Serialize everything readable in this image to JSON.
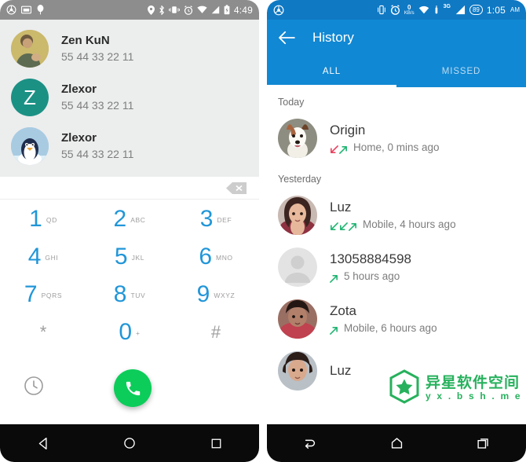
{
  "left_phone": {
    "statusbar": {
      "left_icons": [
        "steering-wheel-icon",
        "sd-card-icon",
        "balloon-icon"
      ],
      "right_icons": [
        "location-icon",
        "bluetooth-icon",
        "vibrate-icon",
        "alarm-icon",
        "wifi-icon",
        "signal-icon",
        "battery-icon"
      ],
      "time": "4:49"
    },
    "contacts": [
      {
        "name": "Zen KuN",
        "number": "55 44 33 22 11",
        "avatar_type": "photo-man",
        "avatar_color": "#c9b468"
      },
      {
        "name": "Zlexor",
        "number": "55 44 33 22 11",
        "avatar_type": "letter",
        "avatar_letter": "Z",
        "avatar_color": "#1b9184"
      },
      {
        "name": "Zlexor",
        "number": "55 44 33 22 11",
        "avatar_type": "photo-penguin",
        "avatar_color": "#9fc4dd"
      }
    ],
    "dial_input": {
      "value": "",
      "backspace_label": "backspace-icon"
    },
    "keypad": [
      {
        "digit": "1",
        "letters": "QD"
      },
      {
        "digit": "2",
        "letters": "ABC"
      },
      {
        "digit": "3",
        "letters": "DEF"
      },
      {
        "digit": "4",
        "letters": "GHI"
      },
      {
        "digit": "5",
        "letters": "JKL"
      },
      {
        "digit": "6",
        "letters": "MNO"
      },
      {
        "digit": "7",
        "letters": "PQRS"
      },
      {
        "digit": "8",
        "letters": "TUV"
      },
      {
        "digit": "9",
        "letters": "WXYZ"
      },
      {
        "digit": "*",
        "letters": ""
      },
      {
        "digit": "0",
        "letters": "+"
      },
      {
        "digit": "#",
        "letters": ""
      }
    ],
    "actions": {
      "history_icon": "clock-icon",
      "call_button": "call-icon",
      "call_color": "#0ccd5a",
      "accent_color": "#2196d8"
    },
    "navbar": {
      "back": "back-triangle-icon",
      "home": "home-circle-icon",
      "recents": "recents-square-icon"
    }
  },
  "right_phone": {
    "statusbar": {
      "left_icons": [
        "steering-wheel-icon"
      ],
      "right_icons": [
        "vibrate-icon",
        "alarm-icon",
        "wifi-icon",
        "sim-icon",
        "signal-icon"
      ],
      "net_rate_value": "0",
      "net_rate_unit": "KB/s",
      "network_type": "3G",
      "battery_percent": "89",
      "time": "1:05",
      "ampm": "AM"
    },
    "appbar": {
      "back_icon": "arrow-left-icon",
      "title": "History",
      "brand_color": "#1188d3",
      "tabs": [
        {
          "label": "ALL",
          "active": true
        },
        {
          "label": "MISSED",
          "active": false
        }
      ]
    },
    "history": [
      {
        "section": "Today"
      },
      {
        "name": "Origin",
        "detail": "Home, 0 mins ago",
        "arrows": [
          "missed-incoming-arrow",
          "outgoing-arrow"
        ],
        "avatar_type": "photo-dog",
        "avatar_color": "#8e8d81"
      },
      {
        "section": "Yesterday"
      },
      {
        "name": "Luz",
        "detail": "Mobile, 4 hours ago",
        "arrows": [
          "incoming-arrow",
          "incoming-arrow",
          "outgoing-arrow"
        ],
        "avatar_type": "photo-woman-1",
        "avatar_color": "#a4726a"
      },
      {
        "name": "13058884598",
        "detail": "5 hours ago",
        "arrows": [
          "outgoing-arrow"
        ],
        "avatar_type": "placeholder",
        "avatar_color": "#dcdcdc"
      },
      {
        "name": "Zota",
        "detail": "Mobile, 6 hours ago",
        "arrows": [
          "outgoing-arrow"
        ],
        "avatar_type": "photo-woman-2",
        "avatar_color": "#7d4b46"
      },
      {
        "name": "Luz",
        "detail": "",
        "arrows": [],
        "avatar_type": "photo-woman-3",
        "avatar_color": "#6d4b44"
      }
    ],
    "navbar": {
      "back": "back-arrow-icon",
      "home": "home-pentagon-icon",
      "recents": "recents-stack-icon"
    }
  },
  "watermark": {
    "logo": "star-hexagon-icon",
    "chinese": "异星软件空间",
    "url": "y x . b s h . m e",
    "color": "#27b15d"
  },
  "colors": {
    "missed_red": "#e8435f",
    "call_green": "#22b573",
    "dial_blue": "#2196d8",
    "status_grey": "#8d8d8d",
    "contacts_bg": "#eceded"
  }
}
